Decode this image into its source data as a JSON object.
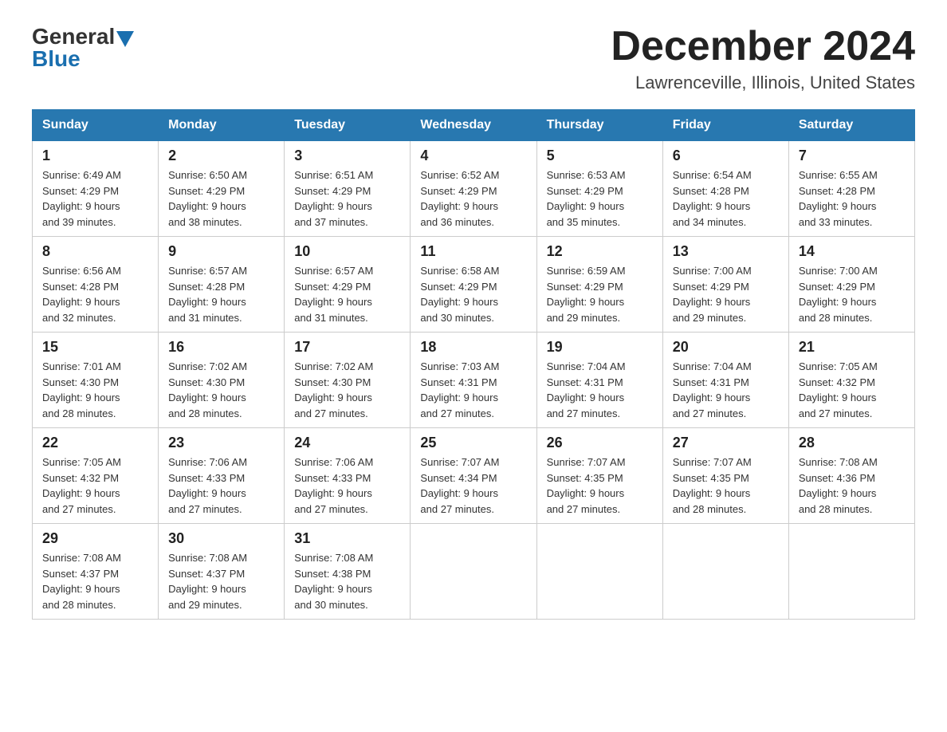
{
  "header": {
    "logo_general": "General",
    "logo_blue": "Blue",
    "title": "December 2024",
    "location": "Lawrenceville, Illinois, United States"
  },
  "days_of_week": [
    "Sunday",
    "Monday",
    "Tuesday",
    "Wednesday",
    "Thursday",
    "Friday",
    "Saturday"
  ],
  "weeks": [
    [
      {
        "num": "1",
        "sunrise": "6:49 AM",
        "sunset": "4:29 PM",
        "daylight": "9 hours and 39 minutes."
      },
      {
        "num": "2",
        "sunrise": "6:50 AM",
        "sunset": "4:29 PM",
        "daylight": "9 hours and 38 minutes."
      },
      {
        "num": "3",
        "sunrise": "6:51 AM",
        "sunset": "4:29 PM",
        "daylight": "9 hours and 37 minutes."
      },
      {
        "num": "4",
        "sunrise": "6:52 AM",
        "sunset": "4:29 PM",
        "daylight": "9 hours and 36 minutes."
      },
      {
        "num": "5",
        "sunrise": "6:53 AM",
        "sunset": "4:29 PM",
        "daylight": "9 hours and 35 minutes."
      },
      {
        "num": "6",
        "sunrise": "6:54 AM",
        "sunset": "4:28 PM",
        "daylight": "9 hours and 34 minutes."
      },
      {
        "num": "7",
        "sunrise": "6:55 AM",
        "sunset": "4:28 PM",
        "daylight": "9 hours and 33 minutes."
      }
    ],
    [
      {
        "num": "8",
        "sunrise": "6:56 AM",
        "sunset": "4:28 PM",
        "daylight": "9 hours and 32 minutes."
      },
      {
        "num": "9",
        "sunrise": "6:57 AM",
        "sunset": "4:28 PM",
        "daylight": "9 hours and 31 minutes."
      },
      {
        "num": "10",
        "sunrise": "6:57 AM",
        "sunset": "4:29 PM",
        "daylight": "9 hours and 31 minutes."
      },
      {
        "num": "11",
        "sunrise": "6:58 AM",
        "sunset": "4:29 PM",
        "daylight": "9 hours and 30 minutes."
      },
      {
        "num": "12",
        "sunrise": "6:59 AM",
        "sunset": "4:29 PM",
        "daylight": "9 hours and 29 minutes."
      },
      {
        "num": "13",
        "sunrise": "7:00 AM",
        "sunset": "4:29 PM",
        "daylight": "9 hours and 29 minutes."
      },
      {
        "num": "14",
        "sunrise": "7:00 AM",
        "sunset": "4:29 PM",
        "daylight": "9 hours and 28 minutes."
      }
    ],
    [
      {
        "num": "15",
        "sunrise": "7:01 AM",
        "sunset": "4:30 PM",
        "daylight": "9 hours and 28 minutes."
      },
      {
        "num": "16",
        "sunrise": "7:02 AM",
        "sunset": "4:30 PM",
        "daylight": "9 hours and 28 minutes."
      },
      {
        "num": "17",
        "sunrise": "7:02 AM",
        "sunset": "4:30 PM",
        "daylight": "9 hours and 27 minutes."
      },
      {
        "num": "18",
        "sunrise": "7:03 AM",
        "sunset": "4:31 PM",
        "daylight": "9 hours and 27 minutes."
      },
      {
        "num": "19",
        "sunrise": "7:04 AM",
        "sunset": "4:31 PM",
        "daylight": "9 hours and 27 minutes."
      },
      {
        "num": "20",
        "sunrise": "7:04 AM",
        "sunset": "4:31 PM",
        "daylight": "9 hours and 27 minutes."
      },
      {
        "num": "21",
        "sunrise": "7:05 AM",
        "sunset": "4:32 PM",
        "daylight": "9 hours and 27 minutes."
      }
    ],
    [
      {
        "num": "22",
        "sunrise": "7:05 AM",
        "sunset": "4:32 PM",
        "daylight": "9 hours and 27 minutes."
      },
      {
        "num": "23",
        "sunrise": "7:06 AM",
        "sunset": "4:33 PM",
        "daylight": "9 hours and 27 minutes."
      },
      {
        "num": "24",
        "sunrise": "7:06 AM",
        "sunset": "4:33 PM",
        "daylight": "9 hours and 27 minutes."
      },
      {
        "num": "25",
        "sunrise": "7:07 AM",
        "sunset": "4:34 PM",
        "daylight": "9 hours and 27 minutes."
      },
      {
        "num": "26",
        "sunrise": "7:07 AM",
        "sunset": "4:35 PM",
        "daylight": "9 hours and 27 minutes."
      },
      {
        "num": "27",
        "sunrise": "7:07 AM",
        "sunset": "4:35 PM",
        "daylight": "9 hours and 28 minutes."
      },
      {
        "num": "28",
        "sunrise": "7:08 AM",
        "sunset": "4:36 PM",
        "daylight": "9 hours and 28 minutes."
      }
    ],
    [
      {
        "num": "29",
        "sunrise": "7:08 AM",
        "sunset": "4:37 PM",
        "daylight": "9 hours and 28 minutes."
      },
      {
        "num": "30",
        "sunrise": "7:08 AM",
        "sunset": "4:37 PM",
        "daylight": "9 hours and 29 minutes."
      },
      {
        "num": "31",
        "sunrise": "7:08 AM",
        "sunset": "4:38 PM",
        "daylight": "9 hours and 30 minutes."
      },
      null,
      null,
      null,
      null
    ]
  ],
  "labels": {
    "sunrise": "Sunrise:",
    "sunset": "Sunset:",
    "daylight": "Daylight:"
  }
}
